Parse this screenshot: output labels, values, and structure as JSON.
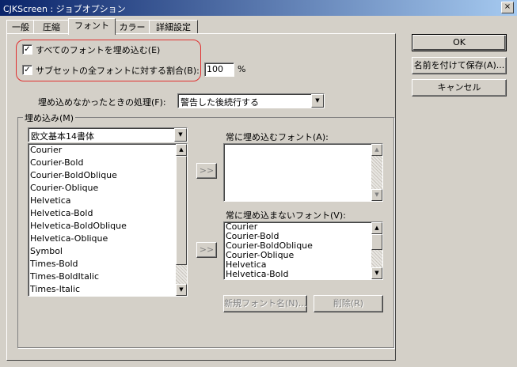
{
  "window": {
    "title": "CJKScreen : ジョブオプション",
    "close_glyph": "×"
  },
  "tabs": [
    {
      "label": "一般"
    },
    {
      "label": "圧縮"
    },
    {
      "label": "フォント"
    },
    {
      "label": "カラー"
    },
    {
      "label": "詳細設定"
    }
  ],
  "buttons": {
    "ok": "OK",
    "save_as": "名前を付けて保存(A)...",
    "cancel": "キャンセル"
  },
  "embed_all": {
    "label": "すべてのフォントを埋め込む(E)",
    "checked": true,
    "check_glyph": "✓"
  },
  "subset": {
    "label": "サブセットの全フォントに対する割合(B):",
    "checked": true,
    "check_glyph": "✓",
    "value": "100",
    "unit": "%"
  },
  "fail_action": {
    "label": "埋め込めなかったときの処理(F):",
    "value": "警告した後続行する"
  },
  "embed_group": {
    "legend": "埋め込み(M)",
    "source_dropdown": "欧文基本14書体",
    "source_list": [
      "Courier",
      "Courier-Bold",
      "Courier-BoldOblique",
      "Courier-Oblique",
      "Helvetica",
      "Helvetica-Bold",
      "Helvetica-BoldOblique",
      "Helvetica-Oblique",
      "Symbol",
      "Times-Bold",
      "Times-BoldItalic",
      "Times-Italic"
    ],
    "add_glyph": ">>",
    "always_embed_label": "常に埋め込むフォント(A):",
    "always_embed_list": [],
    "never_embed_label": "常に埋め込まないフォント(V):",
    "never_embed_list": [
      "Courier",
      "Courier-Bold",
      "Courier-BoldOblique",
      "Courier-Oblique",
      "Helvetica",
      "Helvetica-Bold"
    ],
    "new_font_button": "新規フォント名(N)...",
    "delete_button": "削除(R)"
  },
  "icons": {
    "dropdown_arrow": "▼",
    "scroll_up": "▲",
    "scroll_down": "▼"
  }
}
